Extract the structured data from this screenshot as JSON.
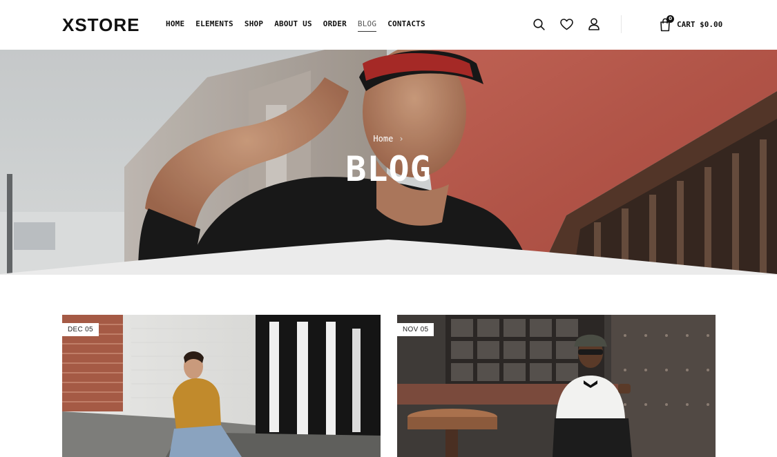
{
  "brand": {
    "logo_text": "XSTORE"
  },
  "nav": {
    "items": [
      {
        "label": "HOME"
      },
      {
        "label": "ELEMENTS"
      },
      {
        "label": "SHOP"
      },
      {
        "label": "ABOUT US"
      },
      {
        "label": "ORDER"
      },
      {
        "label": "BLOG",
        "active": true
      },
      {
        "label": "CONTACTS"
      }
    ]
  },
  "header_icons": [
    "search-icon",
    "heart-icon",
    "user-icon"
  ],
  "cart": {
    "count": "0",
    "label": "CART $0.00"
  },
  "hero": {
    "breadcrumb_home": "Home",
    "breadcrumb_sep": "›",
    "title": "BLOG"
  },
  "posts": [
    {
      "date": "DEC 05"
    },
    {
      "date": "NOV 05"
    }
  ],
  "colors": {
    "wall_red": "#c2574b",
    "shirt_black": "#1b1b1b",
    "sweater_mustard": "#c18a2c"
  }
}
